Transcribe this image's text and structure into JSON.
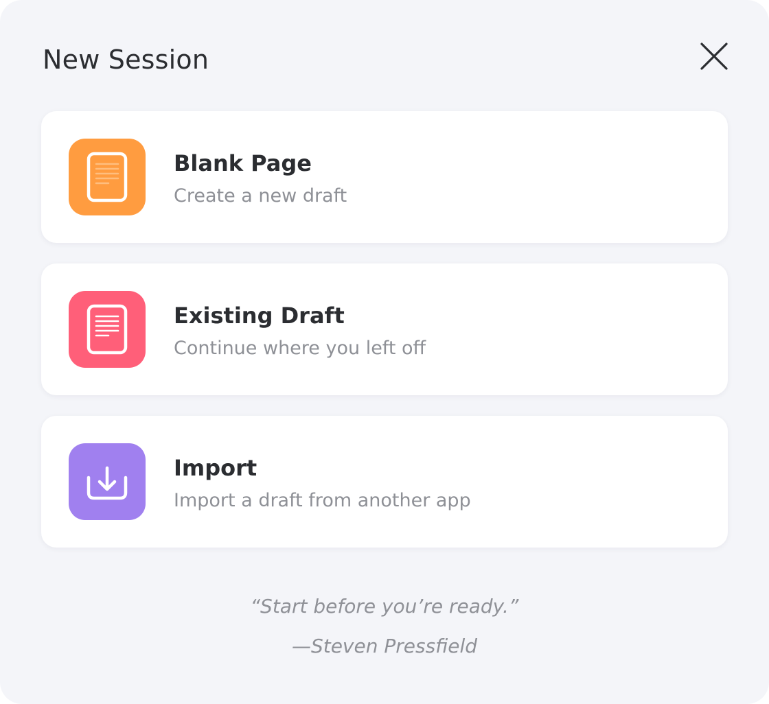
{
  "dialog": {
    "title": "New Session"
  },
  "options": [
    {
      "title": "Blank Page",
      "subtitle": "Create a new draft",
      "icon": "blank-page-icon",
      "color": "#ff9c40"
    },
    {
      "title": "Existing Draft",
      "subtitle": "Continue where you left off",
      "icon": "existing-draft-icon",
      "color": "#ff5f79"
    },
    {
      "title": "Import",
      "subtitle": "Import a draft from another app",
      "icon": "import-icon",
      "color": "#a080ef"
    }
  ],
  "quote": {
    "text": "“Start before you’re ready.”",
    "author": "—Steven Pressfield"
  }
}
